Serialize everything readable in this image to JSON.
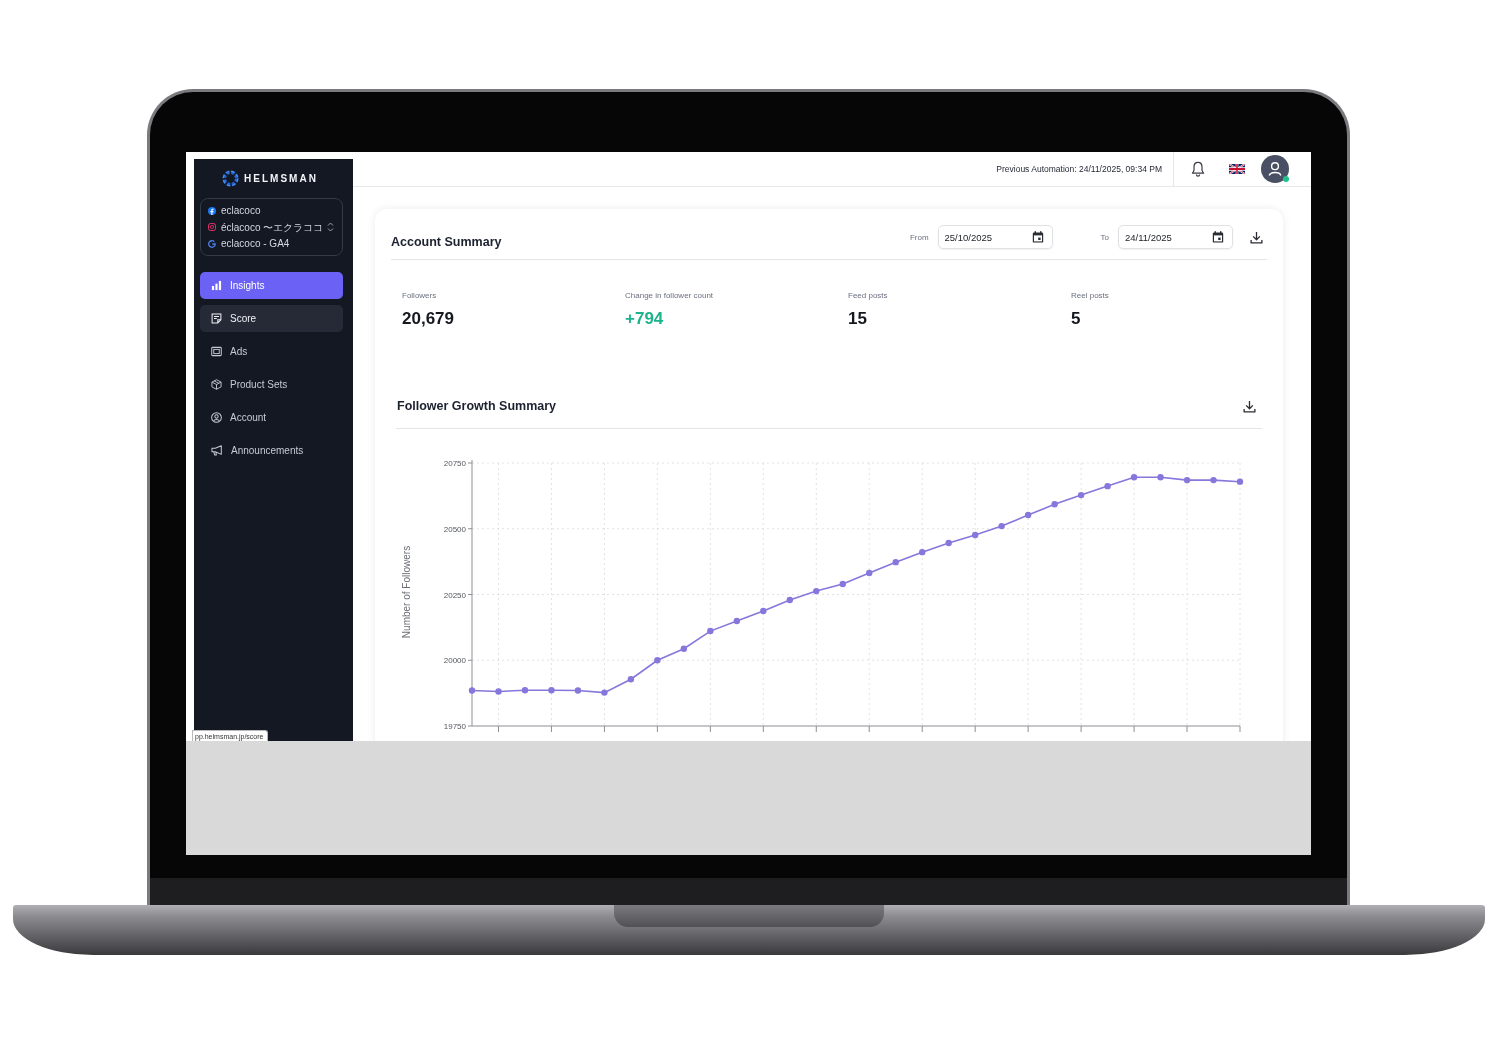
{
  "sidebar": {
    "logo": "HELMSMAN",
    "accounts": [
      {
        "name": "eclacoco"
      },
      {
        "name": "éclacoco 〜エクラココ"
      },
      {
        "name": "eclacoco - GA4"
      }
    ],
    "nav": [
      {
        "label": "Insights",
        "selected": true,
        "hovered": false
      },
      {
        "label": "Score",
        "selected": false,
        "hovered": true
      },
      {
        "label": "Ads",
        "selected": false,
        "hovered": false
      },
      {
        "label": "Product Sets",
        "selected": false,
        "hovered": false
      },
      {
        "label": "Account",
        "selected": false,
        "hovered": false
      },
      {
        "label": "Announcements",
        "selected": false,
        "hovered": false
      }
    ]
  },
  "status_url": "pp.helmsman.jp/score",
  "topbar": {
    "automation": "Previous Automation: 24/11/2025, 09:34 PM",
    "avatar": {
      "online": true
    }
  },
  "account_summary": {
    "title": "Account Summary",
    "from": {
      "label": "From",
      "value": "25/10/2025"
    },
    "to": {
      "label": "To",
      "value": "24/11/2025"
    },
    "stats": [
      {
        "label": "Followers",
        "value": "20,679",
        "kind": "count"
      },
      {
        "label": "Change in follower count",
        "value": "+794",
        "kind": "change"
      },
      {
        "label": "Feed posts",
        "value": "15",
        "kind": "count"
      },
      {
        "label": "Reel posts",
        "value": "5",
        "kind": "count"
      }
    ]
  },
  "growth": {
    "title": "Follower Growth Summary",
    "chart_data": {
      "type": "line",
      "ylabel": "Number of Followers",
      "ylim": [
        19750,
        20750
      ],
      "yticks": [
        19750,
        20000,
        20250,
        20500,
        20750
      ],
      "grid": true,
      "marker": true,
      "values": [
        19885,
        19881,
        19886,
        19886,
        19885,
        19877,
        19928,
        20000,
        20044,
        20111,
        20149,
        20187,
        20229,
        20263,
        20290,
        20332,
        20373,
        20411,
        20446,
        20476,
        20510,
        20552,
        20593,
        20628,
        20662,
        20696,
        20696,
        20685,
        20685,
        20679
      ]
    }
  }
}
